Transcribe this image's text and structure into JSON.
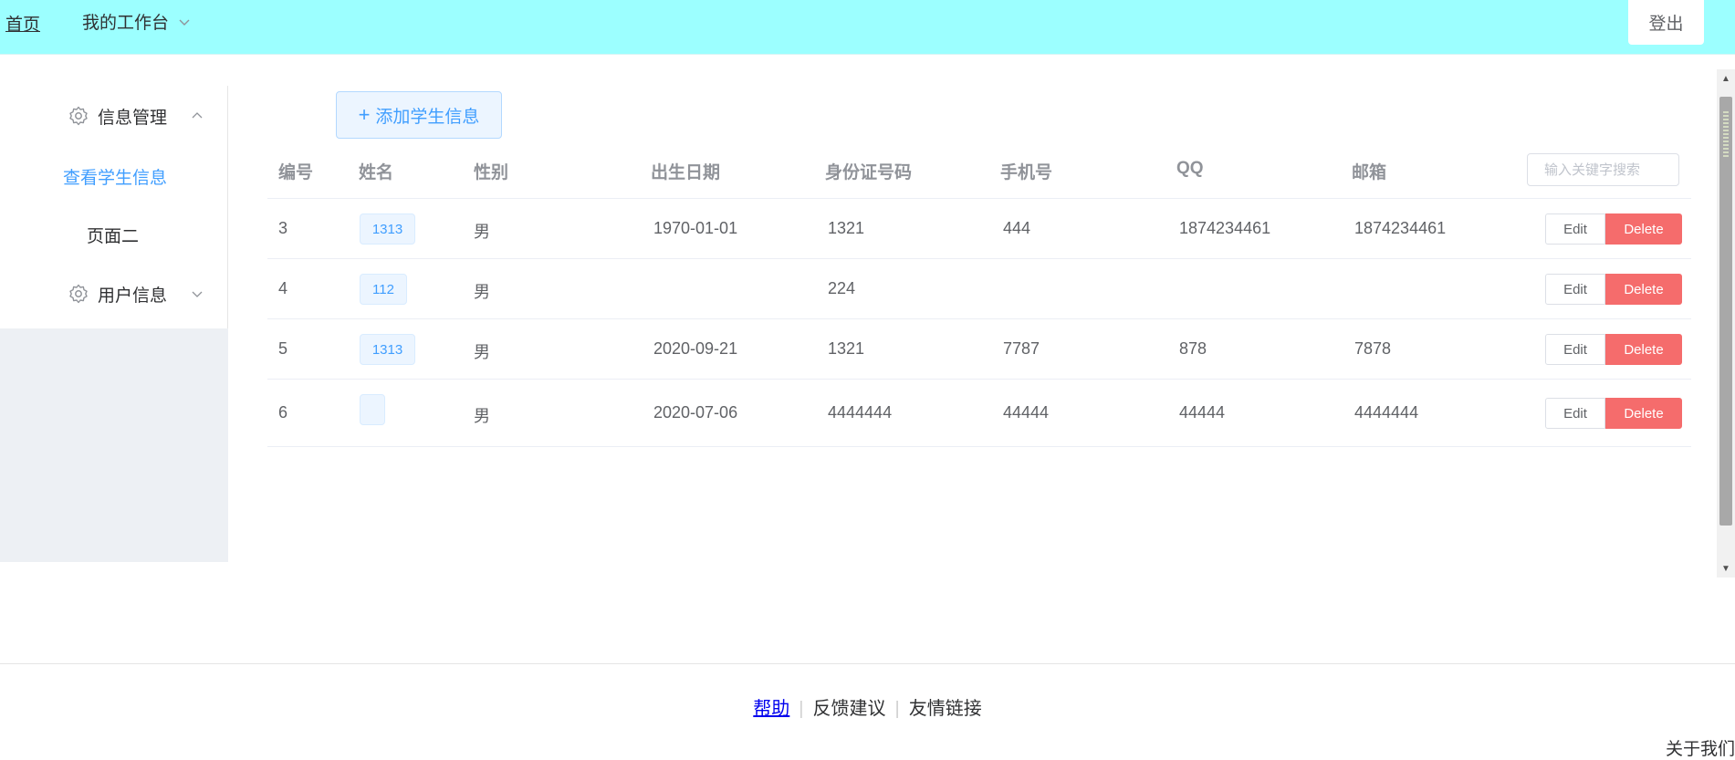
{
  "header": {
    "home": "首页",
    "workspace": "我的工作台",
    "logout": "登出"
  },
  "sidebar": {
    "groups": [
      {
        "label": "信息管理",
        "icon": "gear-icon",
        "expanded": true,
        "items": [
          {
            "label": "查看学生信息",
            "active": true
          },
          {
            "label": "页面二",
            "active": false
          }
        ]
      },
      {
        "label": "用户信息",
        "icon": "gear-icon",
        "expanded": false,
        "items": []
      }
    ]
  },
  "toolbar": {
    "add_label": "添加学生信息",
    "search_placeholder": "输入关键字搜索"
  },
  "table": {
    "columns": [
      "编号",
      "姓名",
      "性别",
      "出生日期",
      "身份证号码",
      "手机号",
      "QQ",
      "邮箱"
    ],
    "rows": [
      {
        "id": "3",
        "name": "1313",
        "gender": "男",
        "birth": "1970-01-01",
        "idcard": "1321",
        "phone": "444",
        "qq": "1874234461",
        "email": "1874234461"
      },
      {
        "id": "4",
        "name": "112",
        "gender": "男",
        "birth": "",
        "idcard": "224",
        "phone": "",
        "qq": "",
        "email": ""
      },
      {
        "id": "5",
        "name": "1313",
        "gender": "男",
        "birth": "2020-09-21",
        "idcard": "1321",
        "phone": "7787",
        "qq": "878",
        "email": "7878"
      },
      {
        "id": "6",
        "name": "",
        "gender": "男",
        "birth": "2020-07-06",
        "idcard": "4444444",
        "phone": "44444",
        "qq": "44444",
        "email": "4444444"
      }
    ],
    "edit_label": "Edit",
    "delete_label": "Delete"
  },
  "footer": {
    "links": [
      "帮助",
      "反馈建议",
      "友情链接"
    ],
    "about": "关于我们"
  },
  "colors": {
    "header_bg": "#9cffff",
    "primary": "#409eff",
    "danger": "#f56c6c",
    "sidebar_fill": "#edf0f4"
  }
}
